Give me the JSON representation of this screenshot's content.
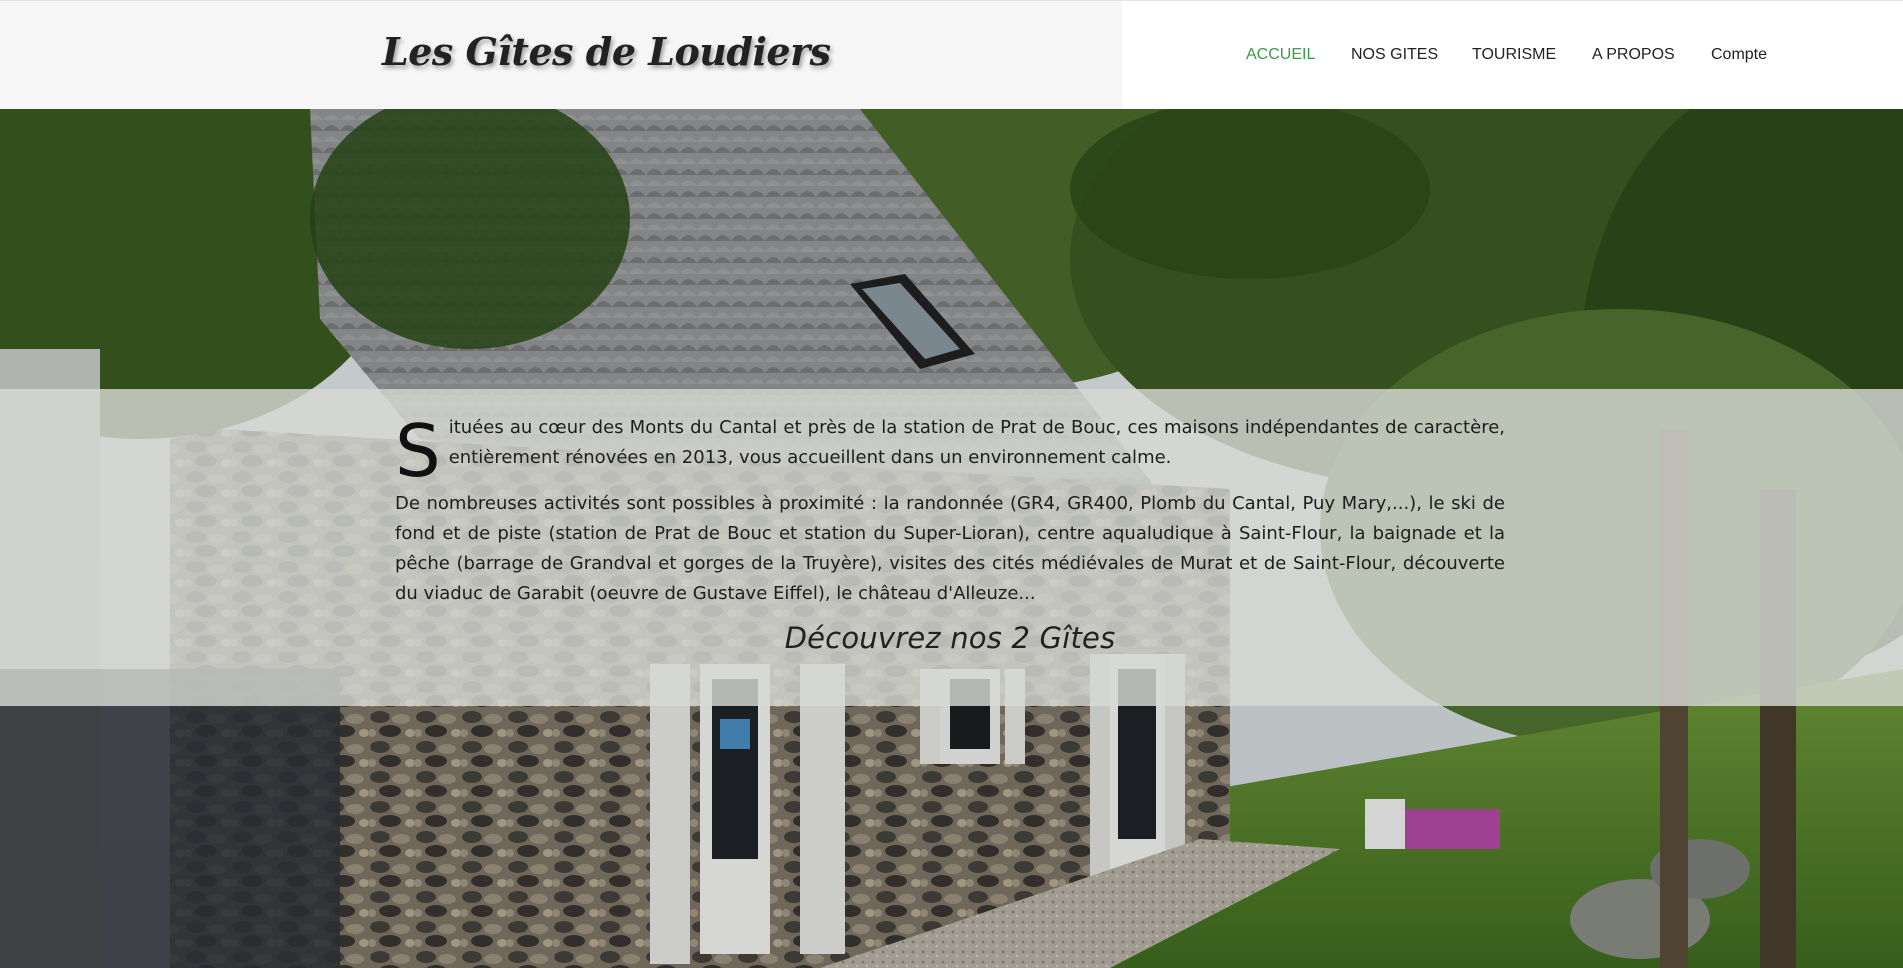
{
  "header": {
    "site_title": "Les Gîtes de Loudiers"
  },
  "nav": {
    "items": [
      {
        "label": "ACCUEIL",
        "active": true
      },
      {
        "label": "NOS GITES",
        "active": false
      },
      {
        "label": "TOURISME",
        "active": false
      },
      {
        "label": "A PROPOS",
        "active": false
      },
      {
        "label": "Compte",
        "active": false
      }
    ],
    "active_color": "#3f9a4a"
  },
  "intro": {
    "dropcap": "S",
    "paragraph1": "ituées au cœur des Monts du Cantal et près de la station de Prat de Bouc, ces maisons indépendantes de caractère, entièrement rénovées en 2013, vous accueillent dans un environnement calme.",
    "paragraph2": "De nombreuses activités sont possibles à proximité : la randonnée (GR4, GR400, Plomb du Cantal, Puy Mary,...), le ski de fond et de piste (station de Prat de Bouc et station du Super-Lioran), centre aqualudique à Saint-Flour, la baignade et la pêche (barrage de Grandval et gorges de la Truyère), visites des cités médiévales de Murat et de Saint-Flour, découverte du viaduc de Garabit (oeuvre de Gustave Eiffel), le château d'Alleuze...",
    "cta": "Découvrez nos 2 Gîtes"
  }
}
